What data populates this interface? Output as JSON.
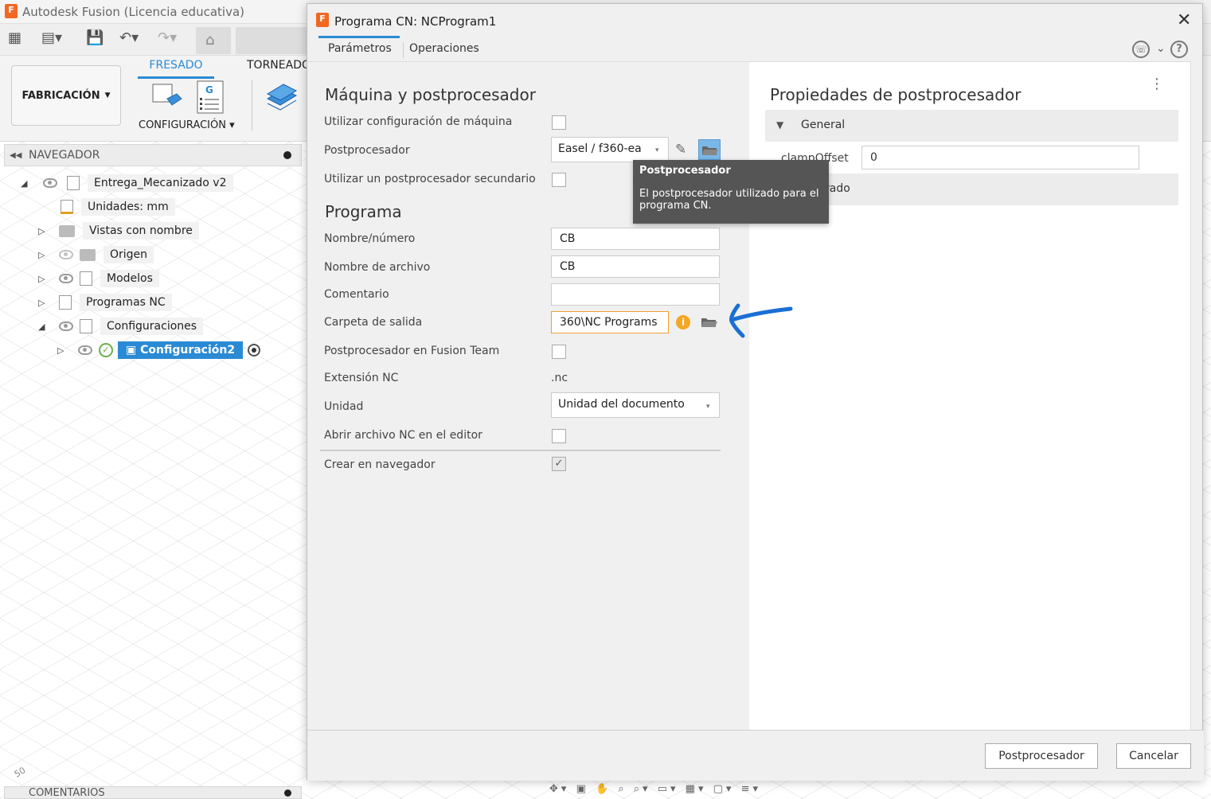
{
  "app": {
    "title": "Autodesk Fusion (Licencia educativa)",
    "logo_letter": "F"
  },
  "ribbon": {
    "workspace_label": "FABRICACIÓN",
    "tab_fresado": "FRESADO",
    "tab_torneado": "TORNEADO",
    "config_label": "CONFIGURACIÓN"
  },
  "navigator": {
    "title": "NAVEGADOR",
    "items": [
      {
        "label": "Entrega_Mecanizado v2"
      },
      {
        "label": "Unidades: mm"
      },
      {
        "label": "Vistas con nombre"
      },
      {
        "label": "Origen"
      },
      {
        "label": "Modelos"
      },
      {
        "label": "Programas NC"
      },
      {
        "label": "Configuraciones"
      },
      {
        "label": "Configuración2"
      }
    ]
  },
  "comments_bar": {
    "label": "COMENTARIOS"
  },
  "dialog": {
    "title": "Programa CN: NCProgram1",
    "tabs": [
      "Parámetros",
      "Operaciones"
    ],
    "section_machine": "Máquina y postprocesador",
    "section_program": "Programa",
    "fields": {
      "use_machine_config": "Utilizar configuración de máquina",
      "postprocessor": "Postprocesador",
      "postprocessor_value": "Easel / f360-ea",
      "secondary_post": "Utilizar un postprocesador secundario",
      "name_number": "Nombre/número",
      "name_number_value": "CB",
      "file_name": "Nombre de archivo",
      "file_name_value": "CB",
      "comment": "Comentario",
      "comment_value": "",
      "output_folder": "Carpeta de salida",
      "output_folder_value": "360\\NC Programs",
      "fusion_team_post": "Postprocesador en Fusion Team",
      "nc_extension": "Extensión NC",
      "nc_extension_value": ".nc",
      "unit": "Unidad",
      "unit_value": "Unidad del documento",
      "open_in_editor": "Abrir archivo NC en el editor",
      "create_in_browser": "Crear en navegador",
      "create_in_browser_checked": true
    },
    "right_panel": {
      "title": "Propiedades de postprocesador",
      "group_general": "General",
      "prop_name": "clampOffset",
      "prop_value": "0",
      "group2_partial": "rado"
    },
    "tooltip": {
      "title": "Postprocesador",
      "body": "El postprocesador utilizado para el programa CN."
    },
    "buttons": {
      "postprocess": "Postprocesador",
      "cancel": "Cancelar"
    }
  },
  "colors": {
    "accent": "#2a8ad4",
    "annotation_arrow": "#1a6fd6",
    "tooltip_bg": "#555555",
    "info_icon": "#f5a623"
  }
}
